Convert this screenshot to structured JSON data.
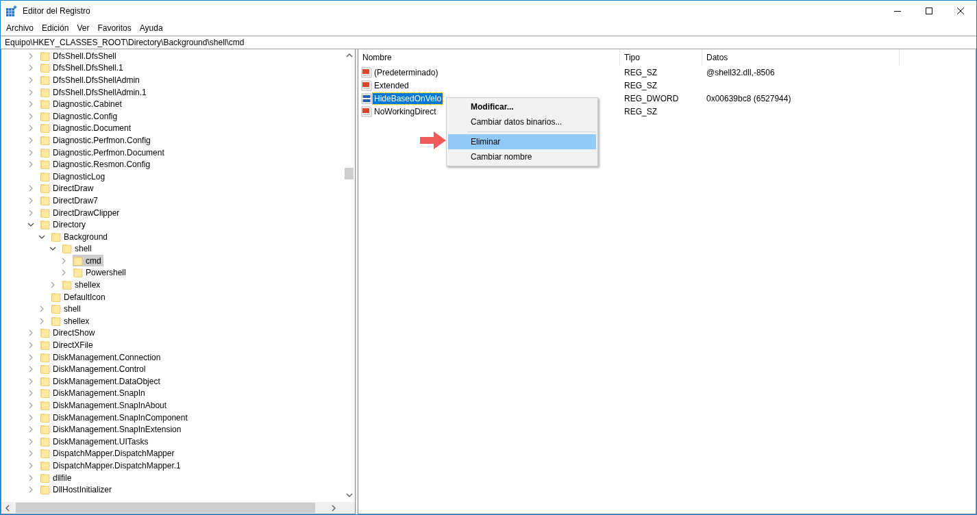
{
  "window": {
    "title": "Editor del Registro"
  },
  "menu": [
    "Archivo",
    "Edición",
    "Ver",
    "Favoritos",
    "Ayuda"
  ],
  "address": "Equipo\\HKEY_CLASSES_ROOT\\Directory\\Background\\shell\\cmd",
  "tree": [
    {
      "label": "DfsShell.DfsShell",
      "expanded": false,
      "selected": false
    },
    {
      "label": "DfsShell.DfsShell.1",
      "expanded": false,
      "selected": false
    },
    {
      "label": "DfsShell.DfsShellAdmin",
      "expanded": false,
      "selected": false
    },
    {
      "label": "DfsShell.DfsShellAdmin.1",
      "expanded": false,
      "selected": false
    },
    {
      "label": "Diagnostic.Cabinet",
      "expanded": false,
      "selected": false
    },
    {
      "label": "Diagnostic.Config",
      "expanded": false,
      "selected": false
    },
    {
      "label": "Diagnostic.Document",
      "expanded": false,
      "selected": false
    },
    {
      "label": "Diagnostic.Perfmon.Config",
      "expanded": false,
      "selected": false
    },
    {
      "label": "Diagnostic.Perfmon.Document",
      "expanded": false,
      "selected": false
    },
    {
      "label": "Diagnostic.Resmon.Config",
      "expanded": false,
      "selected": false
    },
    {
      "label": "DiagnosticLog",
      "leaf": true,
      "selected": false
    },
    {
      "label": "DirectDraw",
      "expanded": false,
      "selected": false
    },
    {
      "label": "DirectDraw7",
      "expanded": false,
      "selected": false
    },
    {
      "label": "DirectDrawClipper",
      "expanded": false,
      "selected": false
    },
    {
      "label": "Directory",
      "expanded": true,
      "selected": false,
      "children": [
        {
          "label": "Background",
          "expanded": true,
          "selected": false,
          "children": [
            {
              "label": "shell",
              "expanded": true,
              "selected": false,
              "children": [
                {
                  "label": "cmd",
                  "expanded": false,
                  "selected": true
                },
                {
                  "label": "Powershell",
                  "expanded": false,
                  "selected": false
                }
              ]
            },
            {
              "label": "shellex",
              "expanded": false,
              "selected": false
            }
          ]
        },
        {
          "label": "DefaultIcon",
          "leaf": true,
          "selected": false
        },
        {
          "label": "shell",
          "expanded": false,
          "selected": false
        },
        {
          "label": "shellex",
          "expanded": false,
          "selected": false
        }
      ]
    },
    {
      "label": "DirectShow",
      "expanded": false,
      "selected": false
    },
    {
      "label": "DirectXFile",
      "expanded": false,
      "selected": false
    },
    {
      "label": "DiskManagement.Connection",
      "expanded": false,
      "selected": false
    },
    {
      "label": "DiskManagement.Control",
      "expanded": false,
      "selected": false
    },
    {
      "label": "DiskManagement.DataObject",
      "expanded": false,
      "selected": false
    },
    {
      "label": "DiskManagement.SnapIn",
      "expanded": false,
      "selected": false
    },
    {
      "label": "DiskManagement.SnapInAbout",
      "expanded": false,
      "selected": false
    },
    {
      "label": "DiskManagement.SnapInComponent",
      "expanded": false,
      "selected": false
    },
    {
      "label": "DiskManagement.SnapInExtension",
      "expanded": false,
      "selected": false
    },
    {
      "label": "DiskManagement.UITasks",
      "expanded": false,
      "selected": false
    },
    {
      "label": "DispatchMapper.DispatchMapper",
      "expanded": false,
      "selected": false
    },
    {
      "label": "DispatchMapper.DispatchMapper.1",
      "expanded": false,
      "selected": false
    },
    {
      "label": "dllfile",
      "expanded": false,
      "selected": false
    },
    {
      "label": "DllHostInitializer",
      "expanded": false,
      "selected": false
    }
  ],
  "values": {
    "columns": [
      "Nombre",
      "Tipo",
      "Datos"
    ],
    "rows": [
      {
        "kind": "string",
        "name": "(Predeterminado)",
        "type": "REG_SZ",
        "data": "@shell32.dll,-8506",
        "selected": false
      },
      {
        "kind": "string",
        "name": "Extended",
        "type": "REG_SZ",
        "selected": false
      },
      {
        "kind": "binary",
        "name": "HideBasedOnVelo",
        "type": "REG_DWORD",
        "data": "0x00639bc8 (6527944)",
        "selected": true
      },
      {
        "kind": "string",
        "name": "NoWorkingDirect",
        "type": "REG_SZ",
        "selected": false
      }
    ]
  },
  "context_menu": [
    {
      "label": "Modificar...",
      "default": true,
      "selected": false
    },
    {
      "label": "Cambiar datos binarios...",
      "default": false,
      "selected": false,
      "separator_after": true
    },
    {
      "label": "Eliminar",
      "default": false,
      "selected": true
    },
    {
      "label": "Cambiar nombre",
      "default": false,
      "selected": false
    }
  ]
}
